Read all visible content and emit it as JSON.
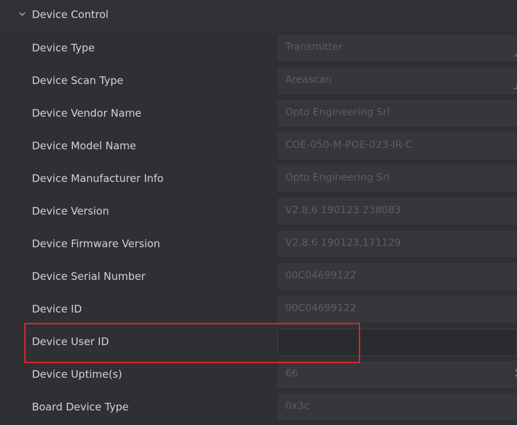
{
  "section": {
    "title": "Device Control",
    "expanded": true
  },
  "rows": [
    {
      "label": "Device Type",
      "value": "Transmitter",
      "control": "combo"
    },
    {
      "label": "Device Scan Type",
      "value": "Areascan",
      "control": "combo"
    },
    {
      "label": "Device Vendor Name",
      "value": "Opto Engineering Srl",
      "control": "readonly"
    },
    {
      "label": "Device Model Name",
      "value": "COE-050-M-POE-023-IR-C",
      "control": "readonly"
    },
    {
      "label": "Device Manufacturer Info",
      "value": "Opto Engineering Srl",
      "control": "readonly"
    },
    {
      "label": "Device Version",
      "value": "V2.8.6 190123 238083",
      "control": "readonly"
    },
    {
      "label": "Device Firmware Version",
      "value": "V2.8.6 190123,171129",
      "control": "readonly"
    },
    {
      "label": "Device Serial Number",
      "value": "00C04699122",
      "control": "readonly"
    },
    {
      "label": "Device ID",
      "value": "00C04699122",
      "control": "readonly"
    },
    {
      "label": "Device User ID",
      "value": "",
      "control": "editable",
      "highlighted": true
    },
    {
      "label": "Device Uptime(s)",
      "value": "66",
      "control": "spin"
    },
    {
      "label": "Board Device Type",
      "value": "0x3c",
      "control": "readonly"
    }
  ],
  "colors": {
    "background": "#2f3033",
    "field": "#35373a",
    "label_text": "#d2d3d5",
    "value_text": "#5b5e63",
    "highlight": "#e0232e"
  }
}
